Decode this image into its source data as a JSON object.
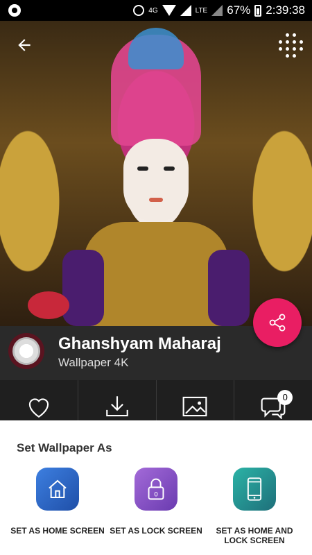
{
  "status_bar": {
    "network_type": "4G",
    "network_type_secondary": "LTE",
    "battery_percent": "67%",
    "time": "2:39:38"
  },
  "info": {
    "title": "Ghanshyam Maharaj",
    "subtitle": "Wallpaper 4K"
  },
  "actions": {
    "comments_count": "0"
  },
  "sheet": {
    "title": "Set Wallpaper As",
    "options": [
      {
        "label": "SET AS HOME SCREEN",
        "color": "#2f66c6"
      },
      {
        "label": "SET AS LOCK SCREEN",
        "color": "#8a55c8",
        "lock_badge": "0"
      },
      {
        "label": "SET AS HOME AND LOCK SCREEN",
        "color": "#1f9e96"
      }
    ]
  },
  "colors": {
    "fab": "#e91e63",
    "info_bar": "#2a2a2a",
    "action_row": "#1f1f1f"
  }
}
